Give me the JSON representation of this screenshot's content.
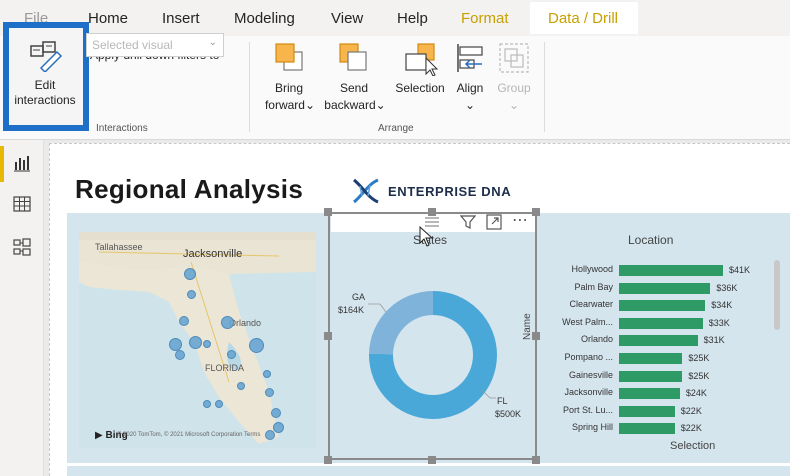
{
  "ribbon_tabs": [
    "File",
    "Home",
    "Insert",
    "Modeling",
    "View",
    "Help",
    "Format",
    "Data / Drill"
  ],
  "active_tab": "Format",
  "ribbon": {
    "edit_interactions": {
      "line1": "Edit",
      "line2": "interactions"
    },
    "apply_drill_label": "Apply drill down filters to",
    "selected_visual_placeholder": "Selected visual",
    "interactions_group": "Interactions",
    "bring_forward": {
      "line1": "Bring",
      "line2": "forward"
    },
    "send_backward": {
      "line1": "Send",
      "line2": "backward"
    },
    "selection": "Selection",
    "align": "Align",
    "group": "Group",
    "arrange_group": "Arrange"
  },
  "report": {
    "title": "Regional Analysis",
    "brand": "ENTERPRISE DNA"
  },
  "map": {
    "labels": [
      "Tallahassee",
      "Jacksonville",
      "Orlando",
      "FLORIDA"
    ],
    "attribution": "© 2020 TomTom, © 2021 Microsoft Corporation Terms",
    "bing": "Bing"
  },
  "donut": {
    "title": "States",
    "ga_label": "GA",
    "ga_value": "$164K",
    "fl_label": "FL",
    "fl_value": "$500K"
  },
  "bar_chart": {
    "title": "Location",
    "axis_label": "Name",
    "x_label": "Selection"
  },
  "chart_data": [
    {
      "type": "pie",
      "title": "States",
      "categories": [
        "FL",
        "GA"
      ],
      "values": [
        500,
        164
      ],
      "unit": "$K"
    },
    {
      "type": "bar",
      "title": "Location",
      "ylabel": "Name",
      "xlabel": "Selection",
      "categories": [
        "Hollywood",
        "Palm Bay",
        "Clearwater",
        "West Palm...",
        "Orlando",
        "Pompano ...",
        "Gainesville",
        "Jacksonville",
        "Port St. Lu...",
        "Spring Hill"
      ],
      "values": [
        41,
        36,
        34,
        33,
        31,
        25,
        25,
        24,
        22,
        22
      ],
      "labels": [
        "$41K",
        "$36K",
        "$34K",
        "$33K",
        "$31K",
        "$25K",
        "$25K",
        "$24K",
        "$22K",
        "$22K"
      ],
      "xlim": [
        0,
        41
      ]
    }
  ],
  "colors": {
    "accent": "#e8b700",
    "highlight_box": "#1e6fc8",
    "bar": "#2e9b67",
    "donut_fl": "#4aa8d8",
    "donut_ga": "#7fb3da"
  }
}
